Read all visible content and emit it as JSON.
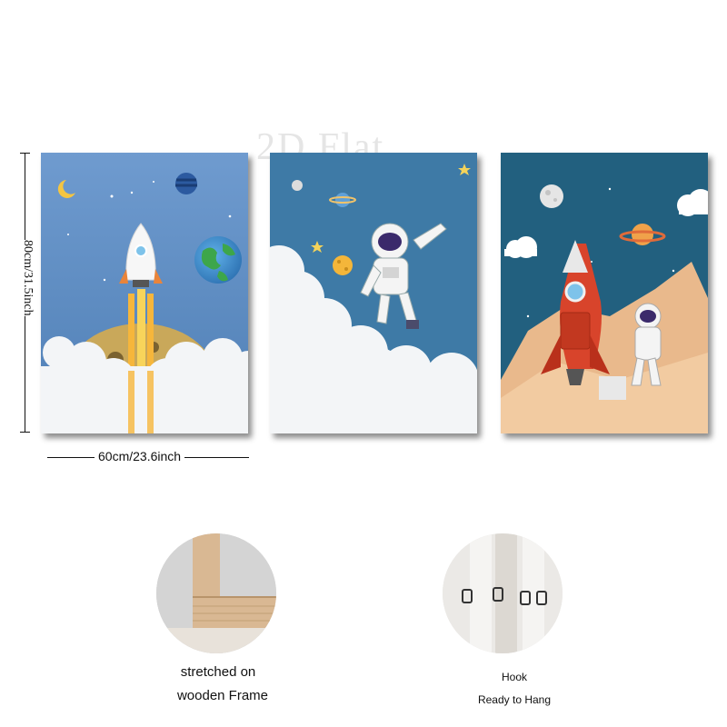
{
  "watermark": "2D Flat",
  "dimensions": {
    "height_label": "80cm/31.5inch",
    "width_label": "60cm/23.6inch"
  },
  "captions": {
    "frame_line1": "stretched on",
    "frame_line2": "wooden Frame",
    "hook_line1": "Hook",
    "hook_line2": "Ready to Hang"
  },
  "panels": [
    {
      "name": "rocket-launch-panel",
      "sky": "#5f8ec3"
    },
    {
      "name": "astronaut-floating-panel",
      "sky": "#3e7aa6"
    },
    {
      "name": "rocket-astronaut-panel",
      "sky": "#22607f"
    }
  ],
  "colors": {
    "rocket_red": "#d8442b",
    "cloud": "#f3f5f7",
    "moon": "#c9a85a",
    "desert": "#e9b98c",
    "wood": "#d9b893"
  }
}
